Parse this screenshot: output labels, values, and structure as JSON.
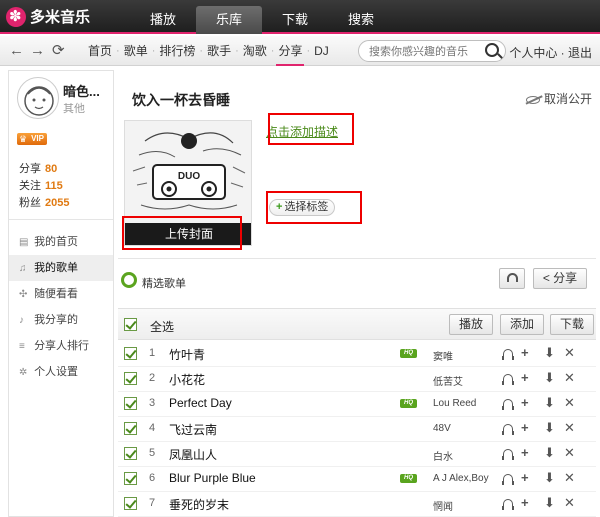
{
  "app": {
    "name": "多米音乐"
  },
  "main_tabs": [
    "播放",
    "乐库",
    "下载",
    "搜索"
  ],
  "active_tab": "乐库",
  "subnav": [
    "首页",
    "歌单",
    "排行榜",
    "歌手",
    "淘歌",
    "分享",
    "DJ"
  ],
  "active_subnav": "分享",
  "search": {
    "placeholder": "搜索你感兴趣的音乐"
  },
  "user_links": "个人中心 · 退出",
  "profile": {
    "name": "暗色...",
    "subtitle": "其他",
    "vip_label": "VIP",
    "stats": [
      {
        "label": "分享",
        "value": "80"
      },
      {
        "label": "关注",
        "value": "115"
      },
      {
        "label": "粉丝",
        "value": "2055"
      }
    ]
  },
  "side_menu": [
    {
      "label": "我的首页",
      "icon": "home-icon"
    },
    {
      "label": "我的歌单",
      "icon": "music-note-icon"
    },
    {
      "label": "随便看看",
      "icon": "compass-icon"
    },
    {
      "label": "我分享的",
      "icon": "share-icon"
    },
    {
      "label": "分享人排行",
      "icon": "rank-icon"
    },
    {
      "label": "个人设置",
      "icon": "gear-icon"
    }
  ],
  "active_side": "我的歌单",
  "playlist": {
    "title": "饮入一杯去昏睡",
    "unpublish_label": "取消公开",
    "upload_cover_label": "上传封面",
    "add_desc_label": "点击添加描述",
    "add_tag_label": "选择标签"
  },
  "featured": {
    "label": "精选歌单",
    "share_label": "分享"
  },
  "list_header": {
    "select_all": "全选",
    "play_label": "播放",
    "add_label": "添加",
    "download_label": "下载"
  },
  "songs": [
    {
      "num": "1",
      "title": "竹叶青",
      "hq": true,
      "artist": "窦唯"
    },
    {
      "num": "2",
      "title": "小花花",
      "hq": false,
      "artist": "低苦艾"
    },
    {
      "num": "3",
      "title": "Perfect Day",
      "hq": true,
      "artist": "Lou Reed"
    },
    {
      "num": "4",
      "title": "飞过云南",
      "hq": false,
      "artist": "48V"
    },
    {
      "num": "5",
      "title": "凤凰山人",
      "hq": false,
      "artist": "白水"
    },
    {
      "num": "6",
      "title": "Blur Purple Blue",
      "hq": true,
      "artist": "A J Alex,Boy"
    },
    {
      "num": "7",
      "title": "垂死的岁末",
      "hq": false,
      "artist": "惘闻"
    }
  ],
  "hq_label": "HQ",
  "colors": {
    "accent": "#e0246d",
    "green": "#59a41e",
    "highlight_box": "#ee0000"
  }
}
